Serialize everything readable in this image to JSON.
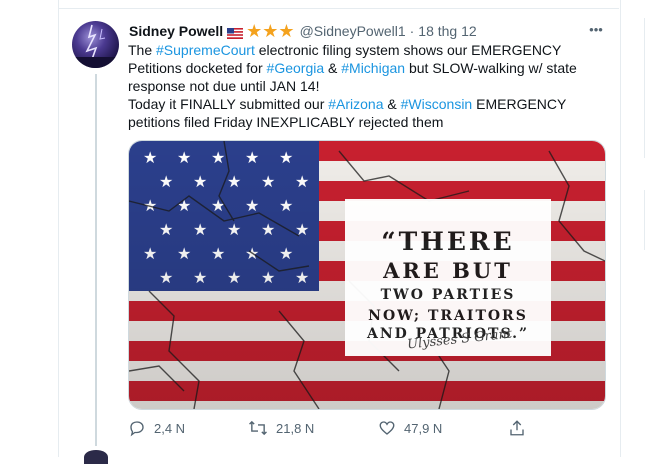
{
  "tweet": {
    "display_name": "Sidney Powell",
    "handle": "@SidneyPowell1",
    "separator": "·",
    "date": "18 thg 12",
    "more_icon": "more-horizontal-icon",
    "lines": [
      [
        {
          "t": "The ",
          "tag": false
        },
        {
          "t": "#SupremeCourt",
          "tag": true
        },
        {
          "t": " electronic filing system shows our EMERGENCY Petitions docketed for ",
          "tag": false
        },
        {
          "t": "#Georgia",
          "tag": true
        },
        {
          "t": " & ",
          "tag": false
        },
        {
          "t": "#Michigan",
          "tag": true
        },
        {
          "t": " but SLOW-walking w/ state response not due until JAN 14!",
          "tag": false
        }
      ],
      [
        {
          "t": "Today it FINALLY submitted our ",
          "tag": false
        },
        {
          "t": "#Arizona",
          "tag": true
        },
        {
          "t": " & ",
          "tag": false
        },
        {
          "t": "#Wisconsin",
          "tag": true
        },
        {
          "t": " EMERGENCY petitions filed Friday INEXPLICABLY rejected them",
          "tag": false
        }
      ]
    ],
    "hashtag_color": "#1b95e0",
    "image": {
      "quote_line1": "“THERE",
      "quote_line2": "ARE BUT",
      "quote_line3": "TWO PARTIES",
      "quote_line4": "NOW; TRAITORS",
      "quote_line5": "AND PATRIOTS.”",
      "signature": "Ulysses S Grant"
    },
    "stats": {
      "replies": "2,4 N",
      "retweets": "21,8 N",
      "likes": "47,9 N"
    }
  },
  "colors": {
    "star_gold": "#f4a21e",
    "text_secondary": "#536471",
    "flag_red": "#c8202f",
    "flag_blue": "#2b3f8c"
  }
}
